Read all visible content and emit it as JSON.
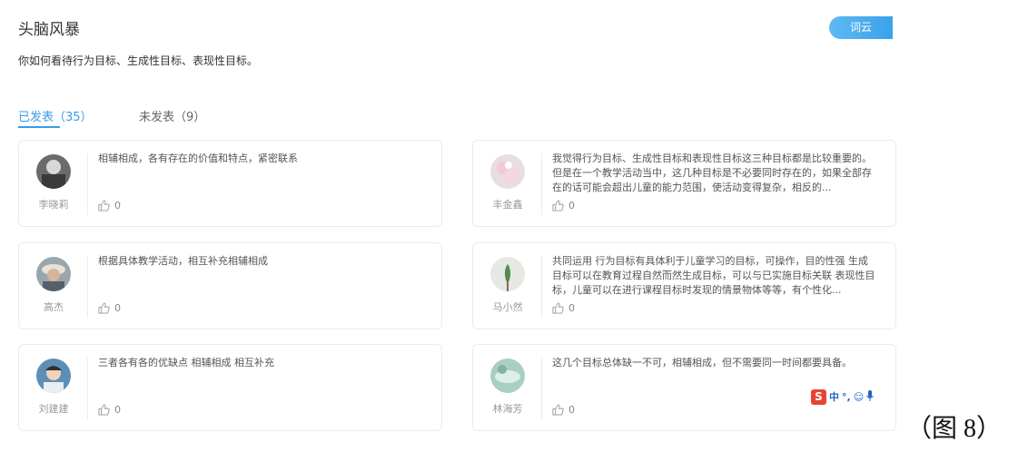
{
  "header": {
    "title": "头脑风暴",
    "wordcloud_label": "词云"
  },
  "question": "你如何看待行为目标、生成性目标、表现性目标。",
  "tabs": {
    "published": "已发表（35）",
    "unpublished": "未发表（9）"
  },
  "posts": [
    {
      "author": "李晓莉",
      "text": "相辅相成，各有存在的价值和特点，紧密联系",
      "likes": "0"
    },
    {
      "author": "丰金鑫",
      "text": "我觉得行为目标、生成性目标和表现性目标这三种目标都是比较重要的。但是在一个教学活动当中，这几种目标是不必要同时存在的，如果全部存在的话可能会超出儿童的能力范围，使活动变得复杂，相反的...",
      "likes": "0"
    },
    {
      "author": "高杰",
      "text": "根据具体教学活动，相互补充相辅相成",
      "likes": "0"
    },
    {
      "author": "马小然",
      "text": "共同运用 行为目标有具体利于儿童学习的目标，可操作，目的性强 生成目标可以在教育过程自然而然生成目标，可以与已实施目标关联 表现性目标，儿童可以在进行课程目标时发现的情景物体等等，有个性化...",
      "likes": "0"
    },
    {
      "author": "刘建建",
      "text": "三者各有各的优缺点 相辅相成 相互补充",
      "likes": "0"
    },
    {
      "author": "林海芳",
      "text": "这几个目标总体缺一不可，相辅相成，但不需要同一时间都要具备。",
      "likes": "0"
    }
  ],
  "ime": {
    "logo": "S",
    "lang": "中",
    "punct": "°,",
    "emoji": "☺",
    "mic": "🎤"
  },
  "figure_caption": "（图 8）"
}
